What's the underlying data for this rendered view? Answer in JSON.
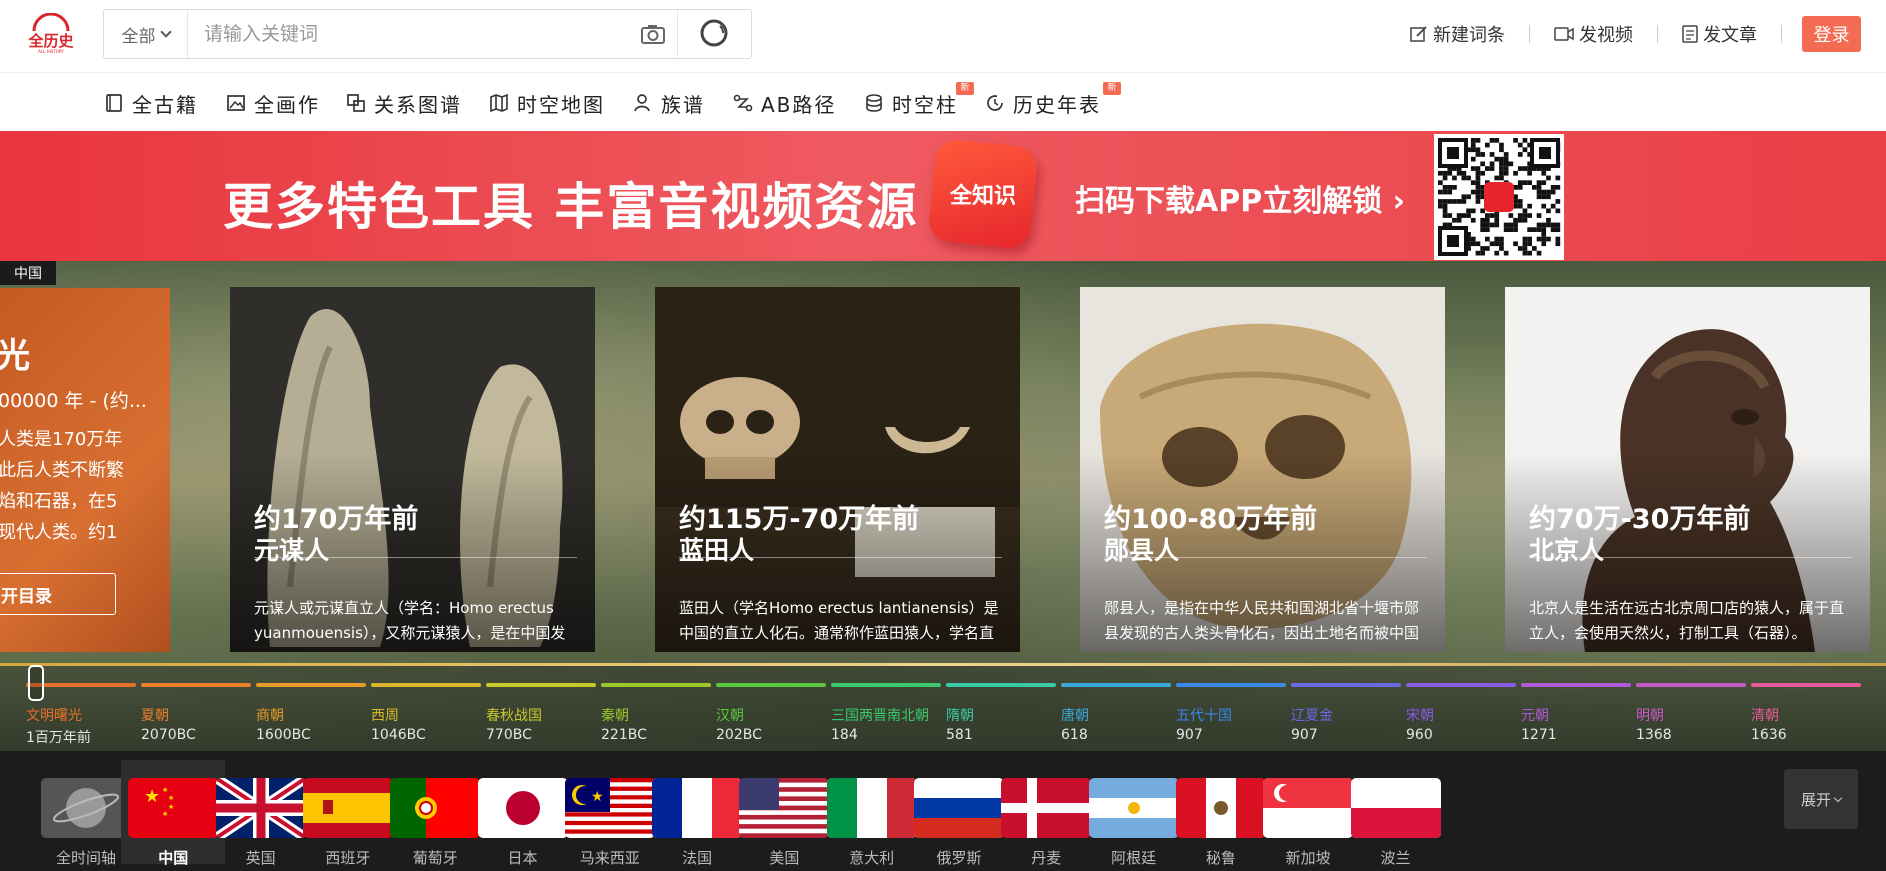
{
  "header": {
    "logo_text": "全历史",
    "logo_sub": "ALL HISTORY",
    "search_scope": "全部",
    "search_placeholder": "请输入关键词",
    "actions": [
      "新建词条",
      "发视频",
      "发文章"
    ],
    "login": "登录"
  },
  "nav": {
    "items": [
      {
        "label": "全古籍",
        "icon": "book-icon"
      },
      {
        "label": "全画作",
        "icon": "painting-icon"
      },
      {
        "label": "关系图谱",
        "icon": "graph-icon"
      },
      {
        "label": "时空地图",
        "icon": "map-icon"
      },
      {
        "label": "族谱",
        "icon": "family-icon"
      },
      {
        "label": "AB路径",
        "icon": "path-icon"
      },
      {
        "label": "时空柱",
        "icon": "cylinder-icon",
        "badge": "新"
      },
      {
        "label": "历史年表",
        "icon": "clock-icon",
        "badge": "新"
      }
    ]
  },
  "banner": {
    "title": "更多特色工具 丰富音视频资源",
    "app_name": "全知识",
    "cta": "扫码下载APP立刻解锁"
  },
  "hero": {
    "region": "中国",
    "intro": {
      "title": "光",
      "date": "00000 年 - (约...",
      "text": "人类是170万年\n此后人类不断繁\n焰和石器，在5\n现代人类。约1",
      "button": "开目录"
    },
    "cards": [
      {
        "date": "约170万年前",
        "name": "元谋人",
        "desc": "元谋人或元谋直立人（学名：Homo erectus yuanmouensis），又称元谋猿人，是在中国发"
      },
      {
        "date": "约115万-70万年前",
        "name": "蓝田人",
        "desc": "蓝田人（学名Homo erectus lantianensis）是中国的直立人化石。通常称作蓝田猿人，学名直"
      },
      {
        "date": "约100-80万年前",
        "name": "郧县人",
        "desc": "郧县人，是指在中华人民共和国湖北省十堰市郧县发现的古人类头骨化石，因出土地名而被中国"
      },
      {
        "date": "约70万-30万年前",
        "name": "北京人",
        "desc": "北京人是生活在远古北京周口店的猿人，属于直立人，会使用天然火，打制工具（石器）。"
      }
    ]
  },
  "timeline": {
    "periods": [
      {
        "name": "文明曙光",
        "year": "1百万年前",
        "color": "#e8702a"
      },
      {
        "name": "夏朝",
        "year": "2070BC",
        "color": "#e8802a"
      },
      {
        "name": "商朝",
        "year": "1600BC",
        "color": "#e89a2a"
      },
      {
        "name": "西周",
        "year": "1046BC",
        "color": "#d8b82a"
      },
      {
        "name": "春秋战国",
        "year": "770BC",
        "color": "#c8c82a"
      },
      {
        "name": "秦朝",
        "year": "221BC",
        "color": "#9ac82a"
      },
      {
        "name": "汉朝",
        "year": "202BC",
        "color": "#5ac83a"
      },
      {
        "name": "三国两晋南北朝",
        "year": "184",
        "color": "#3ac86a"
      },
      {
        "name": "隋朝",
        "year": "581",
        "color": "#3ac8a8"
      },
      {
        "name": "唐朝",
        "year": "618",
        "color": "#3aa8d8"
      },
      {
        "name": "五代十国",
        "year": "907",
        "color": "#3a88e8"
      },
      {
        "name": "辽夏金",
        "year": "907",
        "color": "#6a6ae8"
      },
      {
        "name": "宋朝",
        "year": "960",
        "color": "#8a5ae8"
      },
      {
        "name": "元朝",
        "year": "1271",
        "color": "#b05ad8"
      },
      {
        "name": "明朝",
        "year": "1368",
        "color": "#c85ac8"
      },
      {
        "name": "清朝",
        "year": "1636",
        "color": "#e85a9a"
      }
    ]
  },
  "countries": {
    "items": [
      {
        "name": "全时间轴"
      },
      {
        "name": "中国"
      },
      {
        "name": "英国"
      },
      {
        "name": "西班牙"
      },
      {
        "name": "葡萄牙"
      },
      {
        "name": "日本"
      },
      {
        "name": "马来西亚"
      },
      {
        "name": "法国"
      },
      {
        "name": "美国"
      },
      {
        "name": "意大利"
      },
      {
        "name": "俄罗斯"
      },
      {
        "name": "丹麦"
      },
      {
        "name": "阿根廷"
      },
      {
        "name": "秘鲁"
      },
      {
        "name": "新加坡"
      },
      {
        "name": "波兰"
      }
    ],
    "expand_label": "展开"
  }
}
